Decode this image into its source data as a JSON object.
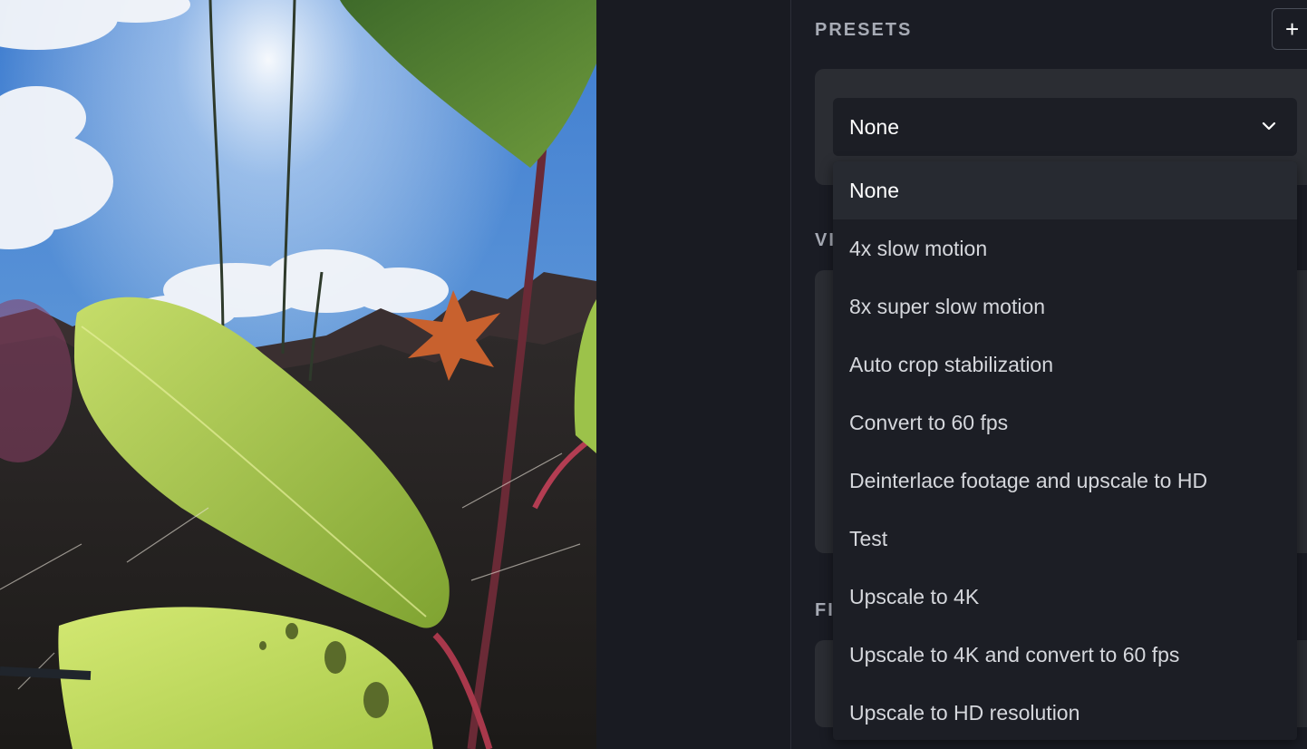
{
  "presets": {
    "section_label": "PRESETS",
    "add_button": "+",
    "selected_value": "None",
    "options": [
      "None",
      "4x slow motion",
      "8x super slow motion",
      "Auto crop stabilization",
      "Convert to 60 fps",
      "Deinterlace footage and upscale to HD",
      "Test",
      "Upscale to 4K",
      "Upscale to 4K and convert to 60 fps",
      "Upscale to HD resolution"
    ]
  },
  "video_section": {
    "label_fragment": "VI"
  },
  "filters_section": {
    "label_fragment": "FI"
  },
  "icons": {
    "chevron": "chevron-down-icon",
    "add": "plus-icon"
  },
  "colors": {
    "panel_bg": "#1a1c24",
    "card_bg": "#2b2d33",
    "select_bg": "#1c1e25",
    "highlight_bg": "#272a31",
    "section_text": "#a7abb5",
    "option_text": "#d5d7dc"
  }
}
